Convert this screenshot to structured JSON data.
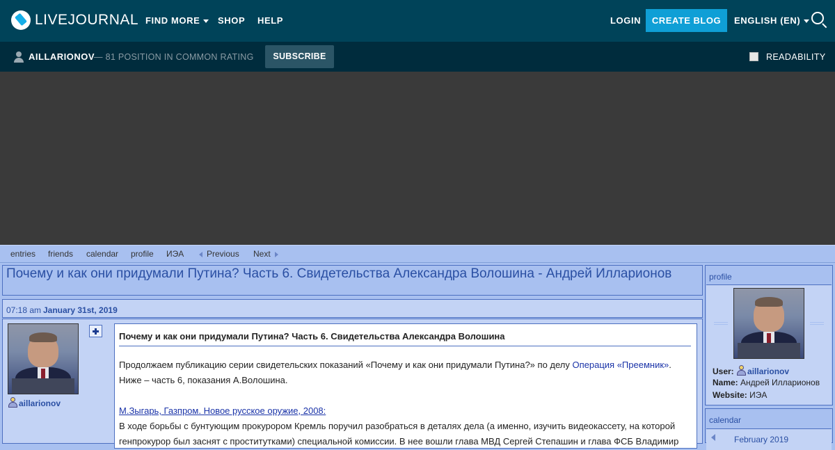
{
  "topbar": {
    "logo_text": "LIVEJOURNAL",
    "nav": [
      "FIND MORE",
      "SHOP",
      "HELP"
    ],
    "login": "LOGIN",
    "create_blog": "CREATE BLOG",
    "language": "ENGLISH (EN)"
  },
  "userbar": {
    "username": "AILLARIONOV",
    "rating": "— 81 POSITION IN COMMON RATING",
    "subscribe": "SUBSCRIBE",
    "readability": "READABILITY"
  },
  "journal_nav": {
    "items": [
      "entries",
      "friends",
      "calendar",
      "profile",
      "ИЭА"
    ],
    "previous": "Previous",
    "next": "Next"
  },
  "post": {
    "page_title": "Почему и как они придумали Путина? Часть 6. Свидетельства Александра Волошина - Андрей Илларионов",
    "time": "07:18 am",
    "date": "January 31st, 2019",
    "author": "aillarionov",
    "title": "Почему и как они придумали Путина? Часть 6. Свидетельства Александра Волошина",
    "p1_before": "Продолжаем публикацию серии свидетельских показаний «Почему и как они придумали Путина?» по делу ",
    "p1_link": "Операция «Преемник»",
    "p1_after": ". Ниже – часть 6, показания А.Волошина.",
    "source_link": "М.Зыгарь, Газпром. Новое русское оружие, 2008:",
    "p3": "В ходе борьбы с бунтующим прокурором Кремль поручил разобраться в деталях дела (а именно, изучить видеокассету, на которой генпрокурор был заснят с проститутками) специальной комиссии. В нее вошли глава МВД Сергей Степашин и глава ФСБ Владимир"
  },
  "sidebar": {
    "profile_head": "profile",
    "user_label": "User:",
    "user_value": "aillarionov",
    "name_label": "Name:",
    "name_value": "Андрей Илларионов",
    "website_label": "Website:",
    "website_value": "ИЭА",
    "calendar_head": "calendar",
    "calendar_month": "February 2019"
  },
  "colors": {
    "topbar": "#004359",
    "userbar": "#002c3d",
    "create_blog": "#0f9fd6",
    "journal_bg": "#a8c0f0",
    "link": "#1a33a8"
  }
}
